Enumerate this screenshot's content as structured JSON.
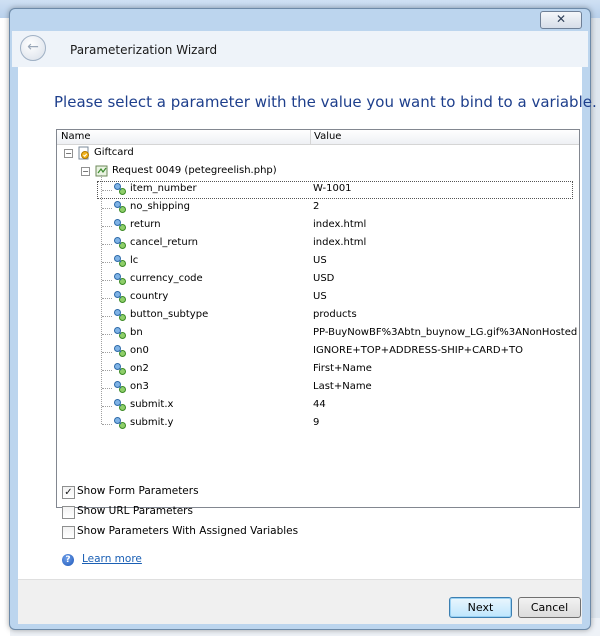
{
  "window": {
    "close_glyph": "✕",
    "title": "Parameterization Wizard"
  },
  "prompt": "Please select a parameter with the value you want to bind to a variable.",
  "grid": {
    "columns": {
      "name": "Name",
      "value": "Value"
    },
    "root": {
      "label": "Giftcard",
      "expanded": true
    },
    "request": {
      "label": "Request 0049 (petegreelish.php)",
      "expanded": true
    },
    "params": [
      {
        "name": "item_number",
        "value": "W-1001",
        "selected": true
      },
      {
        "name": "no_shipping",
        "value": "2"
      },
      {
        "name": "return",
        "value": "index.html"
      },
      {
        "name": "cancel_return",
        "value": "index.html"
      },
      {
        "name": "lc",
        "value": "US"
      },
      {
        "name": "currency_code",
        "value": "USD"
      },
      {
        "name": "country",
        "value": "US"
      },
      {
        "name": "button_subtype",
        "value": "products"
      },
      {
        "name": "bn",
        "value": "PP-BuyNowBF%3Abtn_buynow_LG.gif%3ANonHosted"
      },
      {
        "name": "on0",
        "value": "IGNORE+TOP+ADDRESS-SHIP+CARD+TO"
      },
      {
        "name": "on2",
        "value": "First+Name"
      },
      {
        "name": "on3",
        "value": "Last+Name"
      },
      {
        "name": "submit.x",
        "value": "44"
      },
      {
        "name": "submit.y",
        "value": "9"
      }
    ]
  },
  "options": [
    {
      "label": "Show Form Parameters",
      "checked": true
    },
    {
      "label": "Show URL Parameters",
      "checked": false
    },
    {
      "label": "Show Parameters With Assigned Variables",
      "checked": false
    }
  ],
  "help": {
    "label": "Learn more"
  },
  "buttons": {
    "next": "Next",
    "cancel": "Cancel"
  },
  "icons": {
    "tree_root": "script-icon",
    "tree_request": "request-icon",
    "tree_param": "parameter-icon",
    "help": "help-icon",
    "back": "back-arrow-icon",
    "close": "close-icon"
  },
  "colors": {
    "prompt": "#1e3f8c",
    "link": "#1a5fb4",
    "window_frame": "#bcd5ee"
  }
}
